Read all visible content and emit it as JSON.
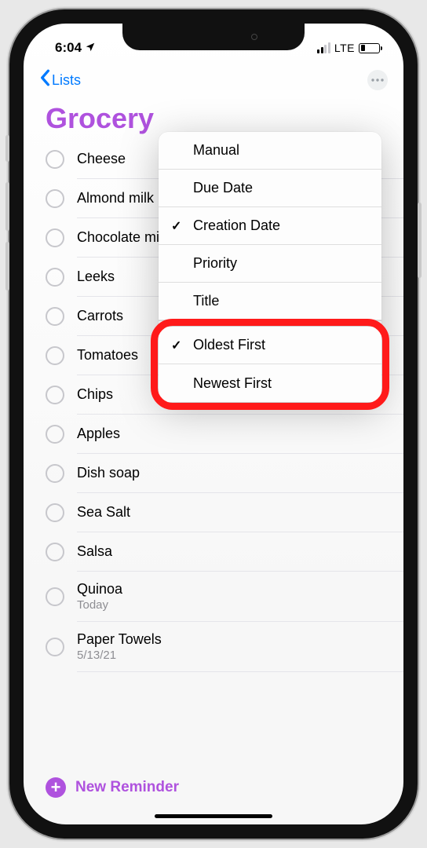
{
  "status": {
    "time": "6:04",
    "network": "LTE"
  },
  "nav": {
    "back_label": "Lists"
  },
  "list": {
    "title": "Grocery",
    "new_reminder_label": "New Reminder"
  },
  "items": [
    {
      "title": "Cheese",
      "sub": null
    },
    {
      "title": "Almond milk",
      "sub": null
    },
    {
      "title": "Chocolate milk",
      "sub": null
    },
    {
      "title": "Leeks",
      "sub": null
    },
    {
      "title": "Carrots",
      "sub": null
    },
    {
      "title": "Tomatoes",
      "sub": null
    },
    {
      "title": "Chips",
      "sub": null
    },
    {
      "title": "Apples",
      "sub": null
    },
    {
      "title": "Dish soap",
      "sub": null
    },
    {
      "title": "Sea Salt",
      "sub": null
    },
    {
      "title": "Salsa",
      "sub": null
    },
    {
      "title": "Quinoa",
      "sub": "Today"
    },
    {
      "title": "Paper Towels",
      "sub": "5/13/21"
    }
  ],
  "menu": {
    "sort_options": [
      {
        "label": "Manual",
        "checked": false
      },
      {
        "label": "Due Date",
        "checked": false
      },
      {
        "label": "Creation Date",
        "checked": true
      },
      {
        "label": "Priority",
        "checked": false
      },
      {
        "label": "Title",
        "checked": false
      }
    ],
    "order_options": [
      {
        "label": "Oldest First",
        "checked": true
      },
      {
        "label": "Newest First",
        "checked": false
      }
    ]
  },
  "annotation": {
    "highlight": "order_options"
  }
}
